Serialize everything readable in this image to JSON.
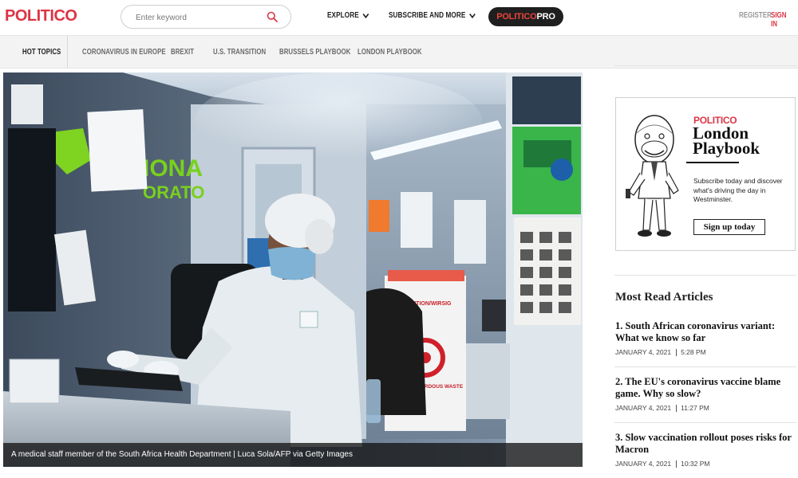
{
  "header": {
    "logo": "POLITICO",
    "search_placeholder": "Enter keyword",
    "nav": [
      {
        "label": "EXPLORE",
        "icon": "chevron-down-icon"
      },
      {
        "label": "SUBSCRIBE AND MORE",
        "icon": "chevron-down-icon"
      }
    ],
    "pro_part1": "POLITICO",
    "pro_part2": "PRO",
    "register": "REGISTER",
    "signin": "SIGN IN"
  },
  "topics": {
    "hot_label": "HOT TOPICS",
    "items": [
      "CORONAVIRUS IN EUROPE",
      "BREXIT",
      "U.S. TRANSITION",
      "BRUSSELS PLAYBOOK",
      "LONDON PLAYBOOK"
    ]
  },
  "hero": {
    "caption": "A medical staff member of the South Africa Health Department | Luca Sola/AFP via Getty Images"
  },
  "promo": {
    "brand": "POLITICO",
    "title": "London Playbook",
    "text": "Subscribe today and discover what's driving the day in Westminster.",
    "button": "Sign up today"
  },
  "most_read": {
    "heading": "Most Read Articles",
    "articles": [
      {
        "title": "1. South African coronavirus variant: What we know so far",
        "date": "JANUARY 4, 2021",
        "time": "5:28 PM"
      },
      {
        "title": "2. The EU's coronavirus vaccine blame game. Why so slow?",
        "date": "JANUARY 4, 2021",
        "time": "11:27 PM"
      },
      {
        "title": "3. Slow vaccination rollout poses risks for Macron",
        "date": "JANUARY 4, 2021",
        "time": "10:32 PM"
      }
    ]
  },
  "colors": {
    "brand_red": "#dc3545",
    "pro_pill_bg": "#1f1f1f",
    "topics_bg": "#f3f3f3"
  }
}
